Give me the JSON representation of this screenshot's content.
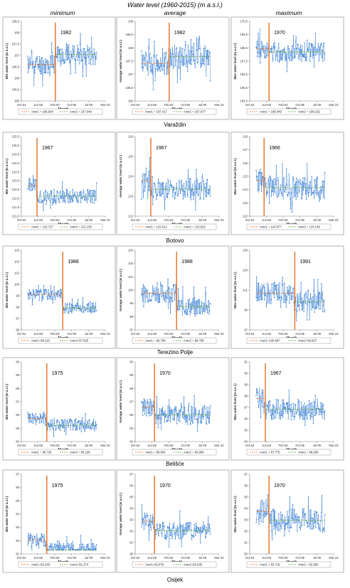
{
  "figure": {
    "title": "Water level (1960-2015) (m a.s.l.)",
    "columns": [
      "minimum",
      "average",
      "maximum"
    ],
    "stations": [
      "Varaždin",
      "Botovo",
      "Terezino Polje",
      "Belišće",
      "Osijek"
    ],
    "x_label": "Month",
    "x_ticks": [
      "Oct-54",
      "Jun-68",
      "Feb-82",
      "Oct-95",
      "Jul-09",
      "Mar-23"
    ],
    "colors": {
      "series": "#3a7fd5",
      "aver1": "#ee6a12",
      "aver2": "#5aa832",
      "change_line": "#e8772e",
      "frame": "#a0a0a0"
    }
  },
  "chart_data": [
    {
      "type": "line",
      "station": "Varaždin",
      "stat": "minimum",
      "ylabel": "Min water level (m a.s.l.)",
      "ylim": [
        165.0,
        168.5
      ],
      "yticks": [
        "165",
        "165,5",
        "166",
        "166,5",
        "167",
        "167,5",
        "168",
        "168,5"
      ],
      "change_year": 1982,
      "change_label": "1982",
      "mean1": 166.604,
      "mean2": 167.049,
      "legend1": "Aver1 = 166.604",
      "legend2": "Aver2 = 167.049",
      "amp": 0.45,
      "seed": 11
    },
    {
      "type": "line",
      "station": "Varaždin",
      "stat": "average",
      "ylabel": "Average water level (m a.s.l.)",
      "ylim": [
        166.0,
        169.0
      ],
      "yticks": [
        "166",
        "166,5",
        "167",
        "167,5",
        "168",
        "168,5",
        "169"
      ],
      "change_year": 1982,
      "change_label": "1982",
      "mean1": 167.417,
      "mean2": 167.677,
      "legend1": "Aver1 = 167.417",
      "legend2": "Aver2 = 167.677",
      "amp": 0.45,
      "seed": 12
    },
    {
      "type": "line",
      "station": "Varaždin",
      "stat": "maximum",
      "ylabel": "Max water level (m a.s.l.)",
      "ylim": [
        164.5,
        170.5
      ],
      "yticks": [
        "164,5",
        "165,5",
        "166,5",
        "167,5",
        "168,5",
        "169,5",
        "170,5"
      ],
      "change_year": 1970,
      "change_label": "1970",
      "mean1": 168.449,
      "mean2": 168.192,
      "legend1": "Aver1 = 168.449",
      "legend2": "Aver2 = 168.192",
      "amp": 0.7,
      "seed": 13
    },
    {
      "type": "line",
      "station": "Botovo",
      "stat": "minimum",
      "ylabel": "Min water level (m a.s.l.)",
      "ylim": [
        121.0,
        125.5
      ],
      "yticks": [
        "121,0",
        "121,5",
        "122,0",
        "122,5",
        "123,0",
        "123,5",
        "124,0",
        "124,5",
        "125,0",
        "125,5"
      ],
      "change_year": 1967,
      "change_label": "1967",
      "mean1": 122.727,
      "mean2": 122.13,
      "legend1": "Aver1 = 122.727",
      "legend2": "Aver2 = 122.130",
      "amp": 0.4,
      "seed": 21
    },
    {
      "type": "line",
      "station": "Botovo",
      "stat": "average",
      "ylabel": "Average water level (m a.s.l.)",
      "ylim": [
        121.5,
        126.0
      ],
      "yticks": [
        "122",
        "123",
        "124",
        "125",
        "126"
      ],
      "change_year": 1967,
      "change_label": "1967",
      "mean1": 123.512,
      "mean2": 123.022,
      "legend1": "Aver1 = 123.512",
      "legend2": "Aver2 = 123.022",
      "amp": 0.6,
      "seed": 22
    },
    {
      "type": "line",
      "station": "Botovo",
      "stat": "maximum",
      "ylabel": "Max water level (m a.s.l.)",
      "ylim": [
        122.0,
        128.0
      ],
      "yticks": [
        "122",
        "123",
        "124",
        "125",
        "126",
        "127",
        "128"
      ],
      "change_year": 1966,
      "change_label": "1966",
      "mean1": 124.677,
      "mean2": 124.149,
      "legend1": "Aver1 = 124.677",
      "legend2": "Aver2 = 124.149",
      "amp": 0.9,
      "seed": 23
    },
    {
      "type": "line",
      "station": "Terezino Polje",
      "stat": "minimum",
      "ylabel": "Min water level (m a.s.l.)",
      "ylim": [
        96.0,
        103.0
      ],
      "yticks": [
        "96",
        "97",
        "98",
        "99",
        "100",
        "101",
        "102",
        "103"
      ],
      "change_year": 1988,
      "change_label": "1988",
      "mean1": 99.115,
      "mean2": 97.925,
      "legend1": "Aver1=99.115",
      "legend2": "Aver2=97.925",
      "amp": 0.45,
      "seed": 31
    },
    {
      "type": "line",
      "station": "Terezino Polje",
      "stat": "average",
      "ylabel": "Average water level (m a.s.l.)",
      "ylim": [
        97.0,
        103.0
      ],
      "yticks": [
        "97",
        "98",
        "99",
        "100",
        "101",
        "102",
        "103"
      ],
      "change_year": 1988,
      "change_label": "1988",
      "mean1": 99.768,
      "mean2": 98.758,
      "legend1": "Aver1 = 99.768",
      "legend2": "Aver2 = 98.758",
      "amp": 0.7,
      "seed": 32
    },
    {
      "type": "line",
      "station": "Terezino Polje",
      "stat": "maximum",
      "ylabel": "Max water level (m a.s.l.)",
      "ylim": [
        97.0,
        105.0
      ],
      "yticks": [
        "97",
        "99",
        "101",
        "103",
        "105"
      ],
      "change_year": 1991,
      "change_label": "1991",
      "mean1": 100.697,
      "mean2": 99.827,
      "legend1": "Aver1=100.697",
      "legend2": "Aver2=99.827",
      "amp": 1.1,
      "seed": 33
    },
    {
      "type": "line",
      "station": "Belišće",
      "stat": "minimum",
      "ylabel": "Min water level (m a.s.l.)",
      "ylim": [
        84.0,
        90.0
      ],
      "yticks": [
        "84",
        "85",
        "86",
        "87",
        "88",
        "89",
        "90"
      ],
      "change_year": 1975,
      "change_label": "1975",
      "mean1": 85.726,
      "mean2": 85.226,
      "legend1": "Aver1 = 85.726",
      "legend2": "Aver2 = 85.226",
      "amp": 0.5,
      "seed": 41
    },
    {
      "type": "line",
      "station": "Belišće",
      "stat": "average",
      "ylabel": "Average water level (m a.s.l.)",
      "ylim": [
        84.0,
        90.0
      ],
      "yticks": [
        "84",
        "85",
        "86",
        "87",
        "88",
        "89",
        "90"
      ],
      "change_year": 1970,
      "change_label": "1970",
      "mean1": 86.584,
      "mean2": 85.996,
      "legend1": "Aver1 = 86.584",
      "legend2": "Aver2 = 85.996",
      "amp": 0.7,
      "seed": 42
    },
    {
      "type": "line",
      "station": "Belišće",
      "stat": "maximum",
      "ylabel": "Max water level (m a.s.l.)",
      "ylim": [
        84.0,
        91.0
      ],
      "yticks": [
        "84",
        "85",
        "86",
        "87",
        "88",
        "89",
        "90",
        "91"
      ],
      "change_year": 1967,
      "change_label": "1967",
      "mean1": 87.775,
      "mean2": 86.83,
      "legend1": "Aver1 = 87.775",
      "legend2": "Aver2 = 86.830",
      "amp": 0.9,
      "seed": 43
    },
    {
      "type": "line",
      "station": "Osijek",
      "stat": "minimum",
      "ylabel": "Min water level (m a.s.l.)",
      "ylim": [
        81.0,
        87.0
      ],
      "yticks": [
        "81",
        "82",
        "83",
        "84",
        "85",
        "86",
        "87"
      ],
      "change_year": 1975,
      "change_label": "1975",
      "mean1": 82.033,
      "mean2": 81.274,
      "legend1": "Aver1=82.033",
      "legend2": "Aver2=81.274",
      "amp": 0.55,
      "seed": 51
    },
    {
      "type": "line",
      "station": "Osijek",
      "stat": "average",
      "ylabel": "Average water level (m a.s.l.)",
      "ylim": [
        80.0,
        87.0
      ],
      "yticks": [
        "80",
        "81",
        "82",
        "83",
        "84",
        "85",
        "86",
        "87"
      ],
      "change_year": 1970,
      "change_label": "1970",
      "mean1": 82.876,
      "mean2": 82.035,
      "legend1": "Aver1=82.876",
      "legend2": "Aver2=82.035",
      "amp": 0.8,
      "seed": 52
    },
    {
      "type": "line",
      "station": "Osijek",
      "stat": "maximum",
      "ylabel": "Max water level (m a.s.l.)",
      "ylim": [
        80.0,
        87.0
      ],
      "yticks": [
        "80",
        "81",
        "82",
        "83",
        "84",
        "85",
        "86",
        "87"
      ],
      "change_year": 1970,
      "change_label": "1970",
      "mean1": 83.719,
      "mean2": 82.95,
      "legend1": "Aver1 = 83.719",
      "legend2": "Aver2 = 82.950",
      "amp": 1.0,
      "seed": 53
    }
  ]
}
